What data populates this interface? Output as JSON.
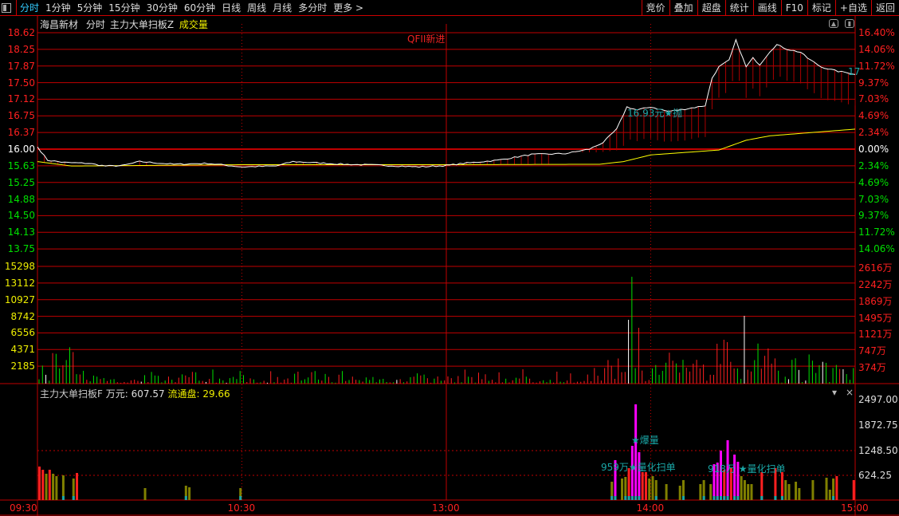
{
  "toolbar": {
    "tabs": [
      "分时",
      "1分钟",
      "5分钟",
      "15分钟",
      "30分钟",
      "60分钟",
      "日线",
      "周线",
      "月线",
      "多分时",
      "更多 >"
    ],
    "right_buttons": [
      "竞价",
      "叠加",
      "超盘",
      "统计",
      "画线",
      "F10",
      "标记",
      "+自选",
      "返回"
    ]
  },
  "header": {
    "stock": "海昌新材",
    "mode": "分时",
    "indicator": "主力大单扫板Z",
    "volume_label": "成交量"
  },
  "price_axis": {
    "left": [
      "18.62",
      "18.25",
      "17.87",
      "17.50",
      "17.12",
      "16.75",
      "16.37",
      "16.00",
      "15.63",
      "15.25",
      "14.88",
      "14.50",
      "14.13",
      "13.75"
    ],
    "right": [
      "16.40%",
      "14.06%",
      "11.72%",
      "9.37%",
      "7.03%",
      "4.69%",
      "2.34%",
      "0.00%",
      "2.34%",
      "4.69%",
      "7.03%",
      "9.37%",
      "11.72%",
      "14.06%"
    ]
  },
  "volume_axis": {
    "left": [
      "15298",
      "13112",
      "10927",
      "8742",
      "6556",
      "4371",
      "2185"
    ],
    "right": [
      "2616万",
      "2242万",
      "1869万",
      "1495万",
      "1121万",
      "747万",
      "374万"
    ]
  },
  "annotations": {
    "qfii": "QFII新进",
    "sell": "16.93元★抛",
    "last": "17",
    "burst": "★爆量",
    "scan1": "959万★量化扫单",
    "scan2": "918万 ★量化扫单"
  },
  "sub_panel": {
    "name": "主力大单扫板F",
    "unit_label": "万元:",
    "unit_value": "607.57",
    "float_label": "流通盘:",
    "float_value": "29.66",
    "axis": [
      "2497.00",
      "1872.75",
      "1248.50",
      "624.25"
    ]
  },
  "time_axis": [
    "09:30",
    "10:30",
    "13:00",
    "14:00",
    "15:00"
  ],
  "colors": {
    "up": "#ff2020",
    "down": "#00e000",
    "grid": "#c00000",
    "avg": "#ffff00",
    "price": "#ffffff",
    "teal": "#1aa6a6",
    "olive": "#808000",
    "magenta": "#ff00ff"
  },
  "chart": {
    "pre_close": 16.0,
    "price_min": 13.75,
    "price_max": 18.62,
    "price_keypoints": [
      [
        0,
        16.05
      ],
      [
        3,
        15.75
      ],
      [
        8,
        15.7
      ],
      [
        15,
        15.68
      ],
      [
        20,
        15.62
      ],
      [
        25,
        15.63
      ],
      [
        30,
        15.72
      ],
      [
        40,
        15.66
      ],
      [
        50,
        15.68
      ],
      [
        60,
        15.6
      ],
      [
        70,
        15.62
      ],
      [
        75,
        15.72
      ],
      [
        90,
        15.66
      ],
      [
        100,
        15.64
      ],
      [
        112,
        15.6
      ],
      [
        120,
        15.63
      ],
      [
        125,
        15.68
      ],
      [
        135,
        15.75
      ],
      [
        145,
        15.88
      ],
      [
        155,
        15.9
      ],
      [
        162,
        16.0
      ],
      [
        166,
        16.15
      ],
      [
        170,
        16.45
      ],
      [
        173,
        16.95
      ],
      [
        176,
        16.88
      ],
      [
        180,
        16.95
      ],
      [
        185,
        16.85
      ],
      [
        190,
        16.9
      ],
      [
        196,
        16.98
      ],
      [
        198,
        17.6
      ],
      [
        200,
        17.85
      ],
      [
        203,
        18.0
      ],
      [
        205,
        18.45
      ],
      [
        208,
        17.85
      ],
      [
        210,
        18.05
      ],
      [
        212,
        17.9
      ],
      [
        215,
        18.2
      ],
      [
        217,
        18.35
      ],
      [
        220,
        18.25
      ],
      [
        224,
        18.18
      ],
      [
        226,
        18.05
      ],
      [
        230,
        17.85
      ],
      [
        235,
        17.75
      ],
      [
        238,
        17.72
      ],
      [
        240,
        17.68
      ]
    ],
    "avg_keypoints": [
      [
        0,
        15.72
      ],
      [
        10,
        15.62
      ],
      [
        60,
        15.65
      ],
      [
        120,
        15.65
      ],
      [
        165,
        15.66
      ],
      [
        172,
        15.72
      ],
      [
        180,
        15.87
      ],
      [
        200,
        15.98
      ],
      [
        208,
        16.2
      ],
      [
        215,
        16.3
      ],
      [
        240,
        16.45
      ]
    ]
  }
}
